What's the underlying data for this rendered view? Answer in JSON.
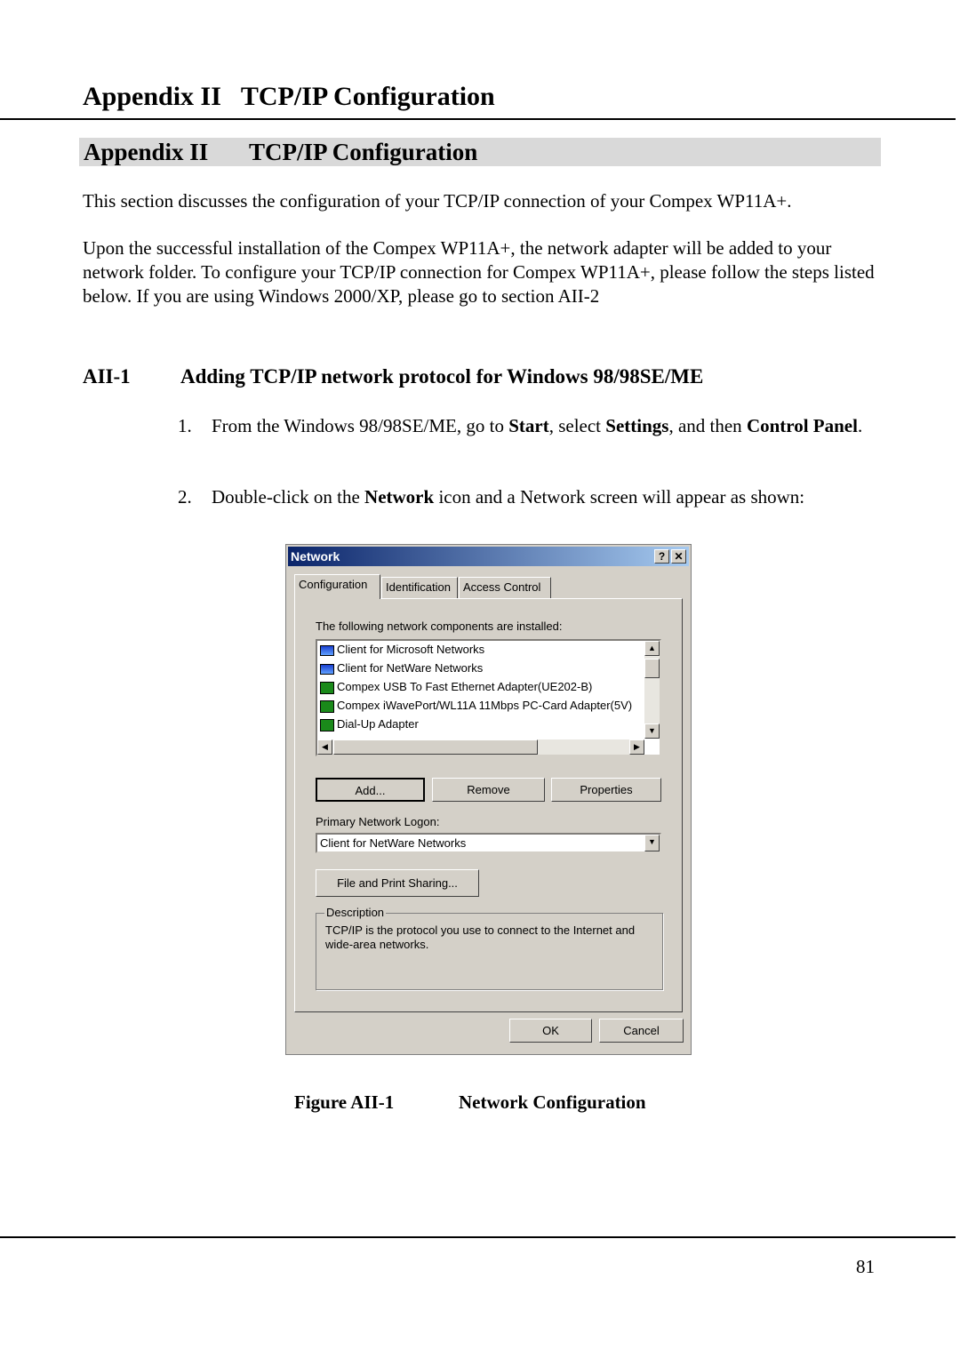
{
  "page": {
    "header_title": "Appendix II   TCP/IP Configuration",
    "section_title_num": "Appendix II",
    "section_title_text": "TCP/IP Configuration",
    "intro": "This section discusses the configuration of your TCP/IP connection of your Compex WP11A+.",
    "para2": "Upon the successful installation of the Compex WP11A+, the network adapter will be added to your network folder. To configure your TCP/IP connection for Compex WP11A+, please follow the steps listed below. If you are using Windows 2000/XP, please go to section AII-2",
    "subsection_num": "AII-1",
    "subsection_title": "Adding TCP/IP network protocol for Windows 98/98SE/ME",
    "steps": [
      {
        "num": "1.",
        "parts": [
          "From the Windows 98/98SE/ME, go to ",
          "Start",
          ", select ",
          "Settings",
          ", and then ",
          "Control Panel",
          "."
        ]
      },
      {
        "num": "2.",
        "parts": [
          "Double-click on the ",
          "Network",
          " icon and a Network screen will appear as shown:"
        ]
      }
    ],
    "caption_num": "Figure AII-1",
    "caption_text": "Network Configuration",
    "page_number": "81"
  },
  "dialog": {
    "title": "Network",
    "help_btn": "?",
    "close_btn": "✕",
    "tabs": [
      "Configuration",
      "Identification",
      "Access Control"
    ],
    "components_label": "The following network components are installed:",
    "components": [
      {
        "icon": "client",
        "label": "Client for Microsoft Networks"
      },
      {
        "icon": "client",
        "label": "Client for NetWare Networks"
      },
      {
        "icon": "adapter",
        "label": "Compex  USB To Fast Ethernet Adapter(UE202-B)"
      },
      {
        "icon": "adapter",
        "label": "Compex iWavePort/WL11A 11Mbps PC-Card Adapter(5V)"
      },
      {
        "icon": "adapter",
        "label": "Dial-Up Adapter"
      }
    ],
    "add_btn": "Add...",
    "remove_btn": "Remove",
    "properties_btn": "Properties",
    "logon_label": "Primary Network Logon:",
    "logon_value": "Client for NetWare Networks",
    "file_print_btn": "File and Print Sharing...",
    "description_legend": "Description",
    "description_text": "TCP/IP is the protocol you use to connect to the Internet and wide-area networks.",
    "ok_btn": "OK",
    "cancel_btn": "Cancel"
  }
}
